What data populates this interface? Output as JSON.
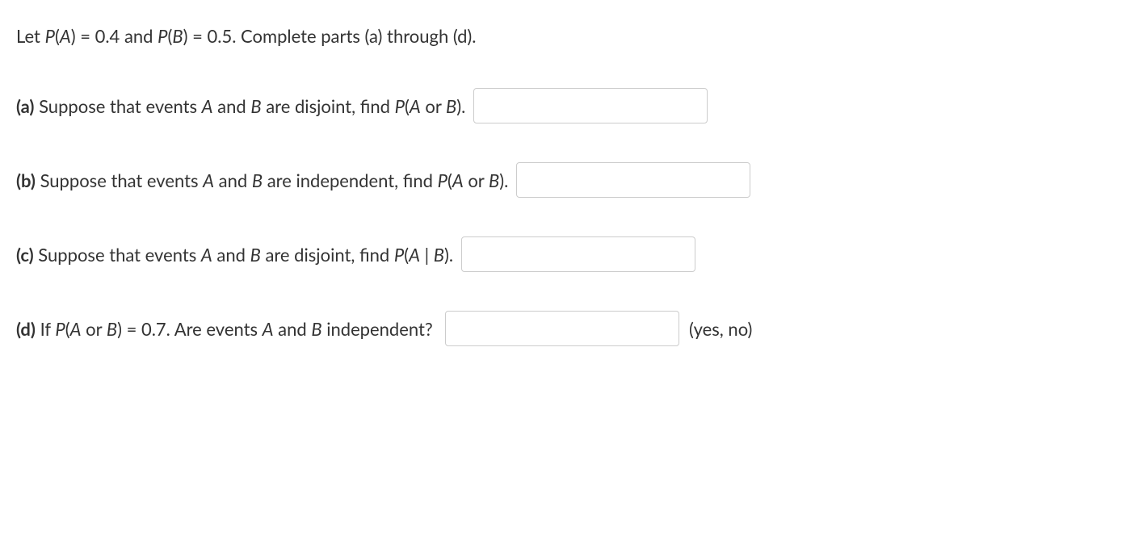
{
  "intro": {
    "t1": "Let ",
    "pa": "P",
    "paren_a": "(",
    "a": "A",
    "paren_ac": ")",
    "eq1": " = 0.4 and ",
    "pb": "P",
    "paren_b": "(",
    "b": "B",
    "paren_bc": ")",
    "eq2": " = 0.5. Complete parts (a) through (d)."
  },
  "parts": {
    "a": {
      "label": "(a)",
      "t1": " Suppose that events ",
      "A": "A",
      "t2": " and ",
      "B": "B",
      "t3": " are disjoint, find ",
      "P": "P",
      "po": "(",
      "AA": "A",
      "or": " or ",
      "BB": "B",
      "pc": ")."
    },
    "b": {
      "label": "(b)",
      "t1": " Suppose that events ",
      "A": "A",
      "t2": " and ",
      "B": "B",
      "t3": " are independent, find ",
      "P": "P",
      "po": "(",
      "AA": "A",
      "or": " or ",
      "BB": "B",
      "pc": ")."
    },
    "c": {
      "label": "(c)",
      "t1": " Suppose that events ",
      "A": "A",
      "t2": " and ",
      "B": "B",
      "t3": " are disjoint, find ",
      "P": "P",
      "po": "(",
      "AA": "A",
      "bar": " | ",
      "BB": "B",
      "pc": ")."
    },
    "d": {
      "label": "(d)",
      "t1": " If ",
      "P": "P",
      "po": "(",
      "AA": "A",
      "or": " or ",
      "BB": "B",
      "pc": ")",
      "eq": " = 0.7. Are events ",
      "A2": "A",
      "t2": " and ",
      "B2": "B",
      "t3": " independent? ",
      "hint": " (yes, no)"
    }
  }
}
